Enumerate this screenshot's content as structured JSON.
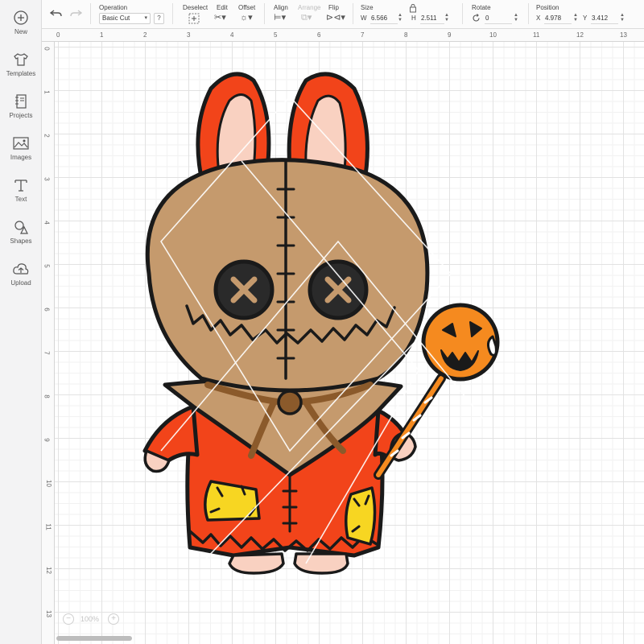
{
  "sidebar": {
    "items": [
      {
        "label": "New",
        "icon": "plus-circle-icon"
      },
      {
        "label": "Templates",
        "icon": "shirt-icon"
      },
      {
        "label": "Projects",
        "icon": "notebook-icon"
      },
      {
        "label": "Images",
        "icon": "image-icon"
      },
      {
        "label": "Text",
        "icon": "text-icon"
      },
      {
        "label": "Shapes",
        "icon": "shapes-icon"
      },
      {
        "label": "Upload",
        "icon": "cloud-upload-icon"
      }
    ]
  },
  "toolbar": {
    "operation_label": "Operation",
    "operation_value": "Basic Cut",
    "help_label": "?",
    "deselect_label": "Deselect",
    "edit_label": "Edit",
    "offset_label": "Offset",
    "align_label": "Align",
    "arrange_label": "Arrange",
    "flip_label": "Flip",
    "size_label": "Size",
    "size_w_letter": "W",
    "size_w_value": "6.566",
    "size_h_letter": "H",
    "size_h_value": "2.511",
    "rotate_label": "Rotate",
    "rotate_value": "0",
    "position_label": "Position",
    "pos_x_letter": "X",
    "pos_x_value": "4.978",
    "pos_y_letter": "Y",
    "pos_y_value": "3.412"
  },
  "ruler": {
    "top": [
      "0",
      "1",
      "2",
      "3",
      "4",
      "5",
      "6",
      "7",
      "8",
      "9",
      "10",
      "11",
      "12",
      "13"
    ],
    "left": [
      "0",
      "1",
      "2",
      "3",
      "4",
      "5",
      "6",
      "7",
      "8",
      "9",
      "10",
      "11",
      "12",
      "13"
    ]
  },
  "zoom": {
    "minus": "−",
    "value": "100%",
    "plus": "+"
  },
  "colors": {
    "accent": "#3a3a3a",
    "orange": "#f2441a",
    "burlap": "#c59a6d",
    "pumpkin": "#f58a1f",
    "patch": "#f7d622"
  }
}
